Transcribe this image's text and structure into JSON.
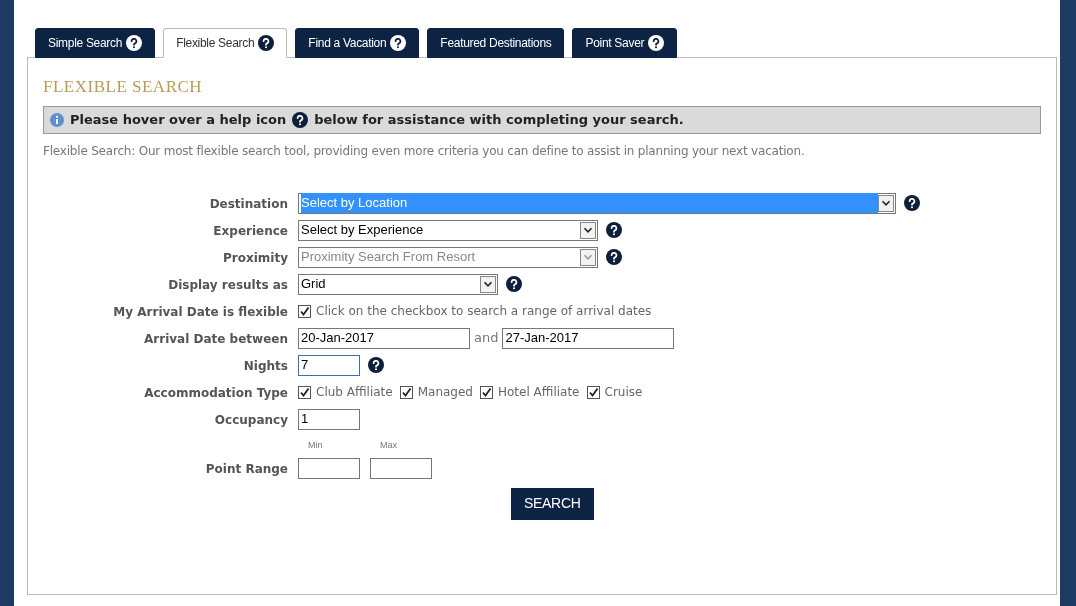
{
  "tabs": [
    {
      "label": "Simple Search",
      "selected": false,
      "help": true
    },
    {
      "label": "Flexible Search",
      "selected": true,
      "help": true
    },
    {
      "label": "Find a Vacation",
      "selected": false,
      "help": true
    },
    {
      "label": "Featured Destinations",
      "selected": false,
      "help": false
    },
    {
      "label": "Point Saver",
      "selected": false,
      "help": true
    }
  ],
  "heading": "FLEXIBLE SEARCH",
  "notice": {
    "before": "Please hover over a help icon",
    "after": "below for assistance with completing your search."
  },
  "description": "Flexible Search: Our most flexible search tool, providing even more criteria you can define to assist in planning your next vacation.",
  "fields": [
    {
      "kind": "select",
      "label": "Destination",
      "value": "Select by Location",
      "highlighted": true,
      "disabled": false,
      "help": true
    },
    {
      "kind": "select",
      "label": "Experience",
      "value": "Select by Experience",
      "highlighted": false,
      "disabled": false,
      "help": true
    },
    {
      "kind": "select",
      "label": "Proximity",
      "value": "Proximity Search From Resort",
      "highlighted": false,
      "disabled": true,
      "help": true
    },
    {
      "kind": "select",
      "label": "Display results as",
      "value": "Grid",
      "highlighted": false,
      "disabled": false,
      "help": true
    },
    {
      "kind": "checkbox",
      "label": "My Arrival Date is flexible",
      "checked": true,
      "text": "Click on the checkbox to search a range of arrival dates"
    },
    {
      "kind": "date_range",
      "label": "Arrival Date between",
      "from": "20-Jan-2017",
      "joiner": "and",
      "to": "27-Jan-2017"
    },
    {
      "kind": "text",
      "label": "Nights",
      "value": "7",
      "focused": true,
      "help": true
    },
    {
      "kind": "checkboxes",
      "label": "Accommodation Type",
      "options": [
        {
          "text": "Club Affiliate",
          "checked": true
        },
        {
          "text": "Managed",
          "checked": true
        },
        {
          "text": "Hotel Affiliate",
          "checked": true
        },
        {
          "text": "Cruise",
          "checked": true
        }
      ]
    },
    {
      "kind": "text",
      "label": "Occupancy",
      "value": "1",
      "focused": false,
      "help": false
    },
    {
      "kind": "range",
      "label": "Point Range",
      "min_label": "Min",
      "max_label": "Max"
    }
  ],
  "search_button": "SEARCH"
}
